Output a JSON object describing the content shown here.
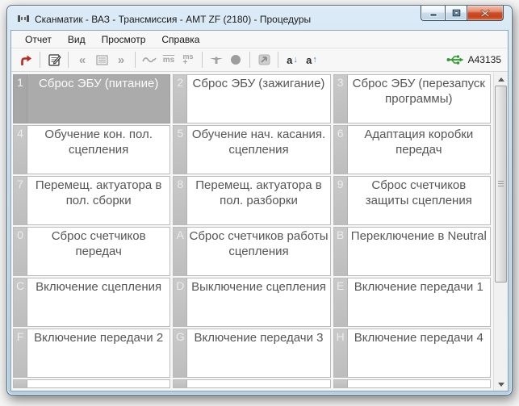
{
  "window": {
    "title": "Сканматик - ВАЗ - Трансмиссия - AMT ZF (2180) - Процедуры"
  },
  "menu": {
    "items": [
      {
        "label": "Отчет"
      },
      {
        "label": "Вид"
      },
      {
        "label": "Просмотр"
      },
      {
        "label": "Справка"
      }
    ]
  },
  "toolbar": {
    "prev_label": "«",
    "next_label": "»",
    "ms_label": "ms",
    "ms_plus_top": "ms",
    "ms_plus_bottom": "+",
    "font_letter": "a",
    "font_down_arrow": "↓",
    "font_up_arrow": "↑",
    "device_id": "A43135"
  },
  "grid": {
    "cells": [
      {
        "tag": "1",
        "label": "Сброс ЭБУ (питание)",
        "selected": true
      },
      {
        "tag": "2",
        "label": "Сброс ЭБУ (зажигание)",
        "selected": false
      },
      {
        "tag": "3",
        "label": "Сброс ЭБУ (перезапуск программы)",
        "selected": false
      },
      {
        "tag": "4",
        "label": "Обучение кон. пол. сцепления",
        "selected": false
      },
      {
        "tag": "5",
        "label": "Обучение нач. касания. сцепления",
        "selected": false
      },
      {
        "tag": "6",
        "label": "Адаптация коробки передач",
        "selected": false
      },
      {
        "tag": "7",
        "label": "Перемещ. актуатора в пол. сборки",
        "selected": false
      },
      {
        "tag": "8",
        "label": "Перемещ. актуатора в пол. разборки",
        "selected": false
      },
      {
        "tag": "9",
        "label": "Сброс счетчиков защиты сцепления",
        "selected": false
      },
      {
        "tag": "0",
        "label": "Сброс счетчиков передач",
        "selected": false
      },
      {
        "tag": "A",
        "label": "Сброс счетчиков работы сцепления",
        "selected": false
      },
      {
        "tag": "B",
        "label": "Переключение в Neutral",
        "selected": false
      },
      {
        "tag": "C",
        "label": "Включение сцепления",
        "selected": false
      },
      {
        "tag": "D",
        "label": "Выключение сцепления",
        "selected": false
      },
      {
        "tag": "E",
        "label": "Включение передачи 1",
        "selected": false
      },
      {
        "tag": "F",
        "label": "Включение передачи 2",
        "selected": false
      },
      {
        "tag": "G",
        "label": "Включение передачи 3",
        "selected": false
      },
      {
        "tag": "H",
        "label": "Включение передачи 4",
        "selected": false
      }
    ]
  }
}
